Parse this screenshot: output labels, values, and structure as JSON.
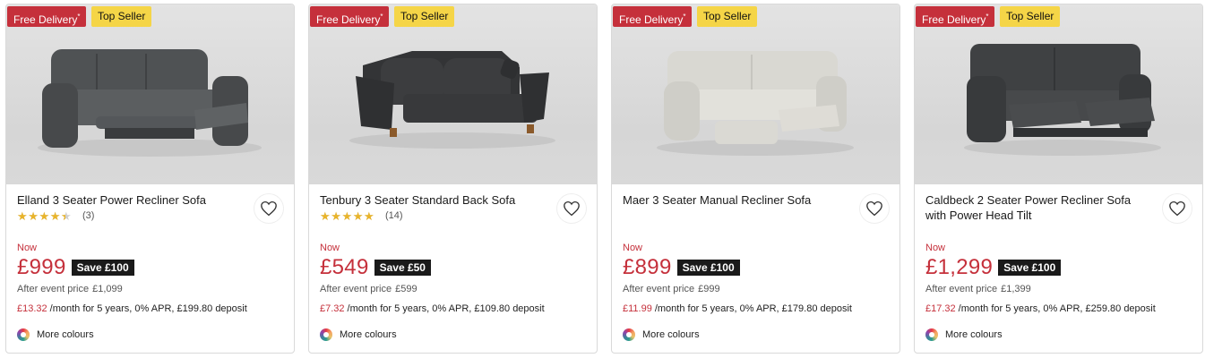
{
  "colors": {
    "accent_red": "#c5303b",
    "badge_yellow": "#f5d547",
    "save_bg": "#1a1a1a",
    "star": "#e9b42a"
  },
  "products": [
    {
      "badges": {
        "free_delivery": "Free Delivery",
        "free_delivery_mark": "*",
        "top_seller": "Top Seller"
      },
      "title": "Elland 3 Seater Power Recliner Sofa",
      "rating": {
        "value": 4,
        "count": "(3)"
      },
      "sofa_color": "dark-grey",
      "now_label": "Now",
      "price": "£999",
      "save": "Save £100",
      "after_label": "After event price",
      "after_price": "£1,099",
      "monthly": "£13.32",
      "finance_terms": "/month for 5 years, 0% APR, £199.80 deposit",
      "more_colours": "More colours",
      "wishlist_icon": "heart-icon"
    },
    {
      "badges": {
        "free_delivery": "Free Delivery",
        "free_delivery_mark": "*",
        "top_seller": "Top Seller"
      },
      "title": "Tenbury 3 Seater Standard Back Sofa",
      "rating": {
        "value": 4.5,
        "count": "(14)"
      },
      "sofa_color": "charcoal",
      "now_label": "Now",
      "price": "£549",
      "save": "Save £50",
      "after_label": "After event price",
      "after_price": "£599",
      "monthly": "£7.32",
      "finance_terms": "/month for 5 years, 0% APR, £109.80 deposit",
      "more_colours": "More colours",
      "wishlist_icon": "heart-icon"
    },
    {
      "badges": {
        "free_delivery": "Free Delivery",
        "free_delivery_mark": "*",
        "top_seller": "Top Seller"
      },
      "title": "Maer 3 Seater Manual Recliner Sofa",
      "rating": null,
      "sofa_color": "cream",
      "now_label": "Now",
      "price": "£899",
      "save": "Save £100",
      "after_label": "After event price",
      "after_price": "£999",
      "monthly": "£11.99",
      "finance_terms": "/month for 5 years, 0% APR, £179.80 deposit",
      "more_colours": "More colours",
      "wishlist_icon": "heart-icon"
    },
    {
      "badges": {
        "free_delivery": "Free Delivery",
        "free_delivery_mark": "*",
        "top_seller": "Top Seller"
      },
      "title": "Caldbeck 2 Seater Power Recliner Sofa with Power Head Tilt",
      "rating": null,
      "sofa_color": "dark-grey",
      "now_label": "Now",
      "price": "£1,299",
      "save": "Save £100",
      "after_label": "After event price",
      "after_price": "£1,399",
      "monthly": "£17.32",
      "finance_terms": "/month for 5 years, 0% APR, £259.80 deposit",
      "more_colours": "More colours",
      "wishlist_icon": "heart-icon"
    }
  ]
}
